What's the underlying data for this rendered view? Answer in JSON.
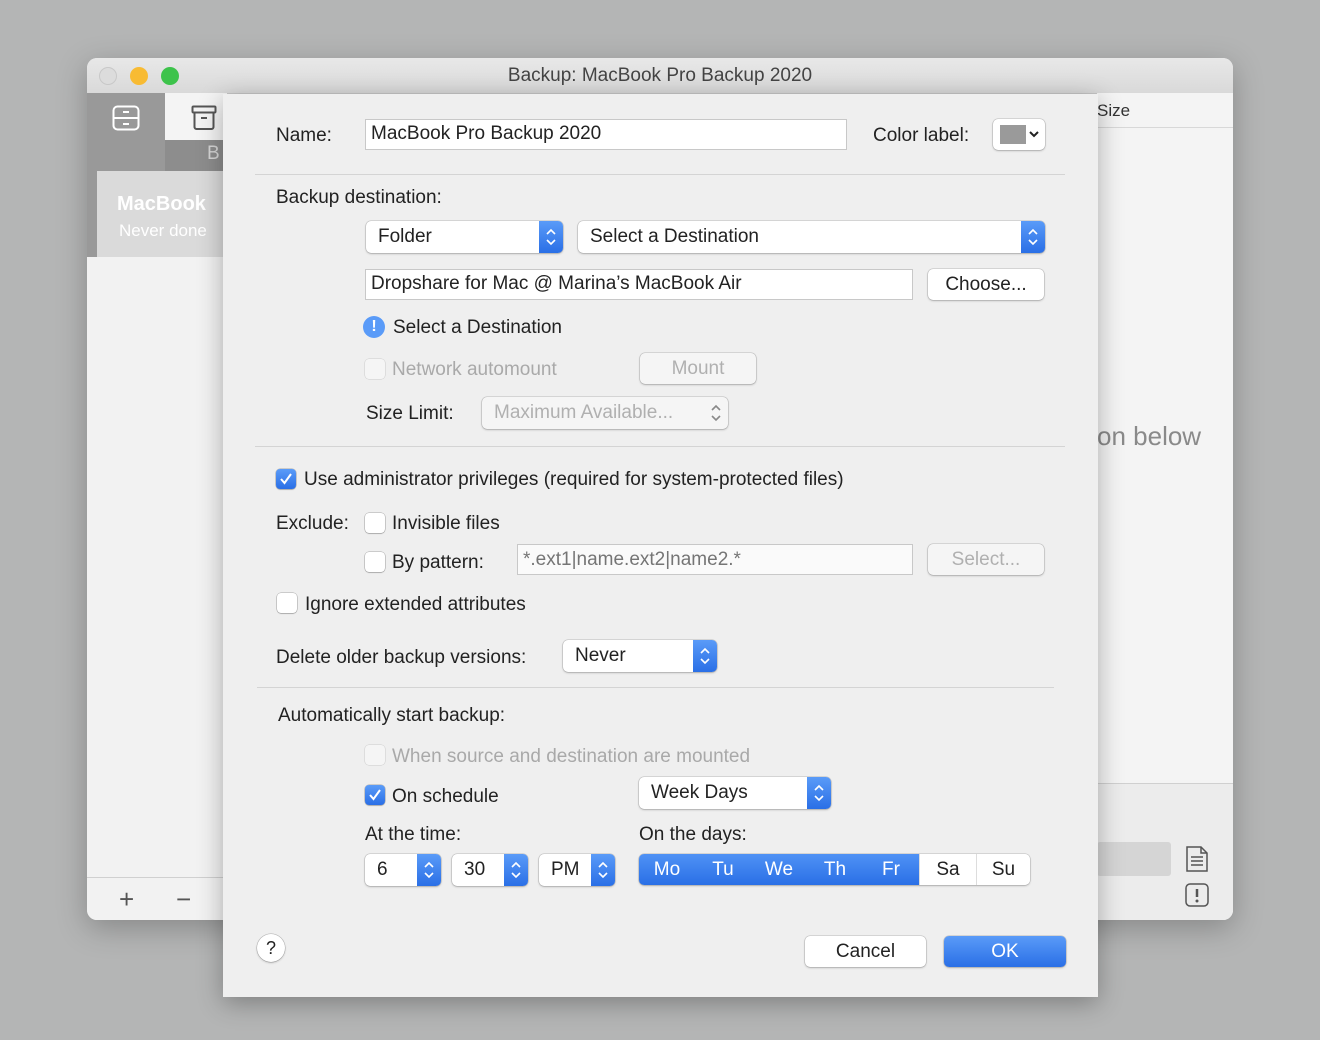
{
  "window": {
    "title": "Backup: MacBook Pro Backup 2020"
  },
  "sidebar": {
    "tab_label_partial": "B",
    "item": {
      "name": "MacBook",
      "status": "Never done"
    },
    "add_label": "+",
    "remove_label": "−"
  },
  "background_pane": {
    "column_header": "Size",
    "placeholder_partial": "on below"
  },
  "sheet": {
    "name_label": "Name:",
    "name_value": "MacBook Pro Backup 2020",
    "color_label": "Color label:",
    "color_value": "#9a9a9a",
    "destination": {
      "heading": "Backup destination:",
      "type_value": "Folder",
      "select_value": "Select a Destination",
      "path_value": "Dropshare for Mac @ Marina’s MacBook Air",
      "choose_label": "Choose...",
      "warning_text": "Select a Destination",
      "network_automount_label": "Network automount",
      "mount_label": "Mount",
      "size_limit_label": "Size Limit:",
      "size_limit_value": "Maximum Available..."
    },
    "admin_label": "Use administrator privileges (required for system-protected files)",
    "exclude_label": "Exclude:",
    "invisible_files_label": "Invisible files",
    "by_pattern_label": "By pattern:",
    "pattern_placeholder": "*.ext1|name.ext2|name2.*",
    "select_label": "Select...",
    "ignore_attrs_label": "Ignore extended attributes",
    "delete_older_label": "Delete older backup versions:",
    "delete_older_value": "Never",
    "auto_heading": "Automatically start backup:",
    "when_mounted_label": "When source and destination are mounted",
    "on_schedule_label": "On schedule",
    "schedule_value": "Week Days",
    "at_time_label": "At the time:",
    "hour_value": "6",
    "minute_value": "30",
    "ampm_value": "PM",
    "on_days_label": "On the days:",
    "days": [
      {
        "label": "Mo",
        "selected": true
      },
      {
        "label": "Tu",
        "selected": true
      },
      {
        "label": "We",
        "selected": true
      },
      {
        "label": "Th",
        "selected": true
      },
      {
        "label": "Fr",
        "selected": true
      },
      {
        "label": "Sa",
        "selected": false
      },
      {
        "label": "Su",
        "selected": false
      }
    ],
    "help_label": "?",
    "cancel_label": "Cancel",
    "ok_label": "OK"
  }
}
